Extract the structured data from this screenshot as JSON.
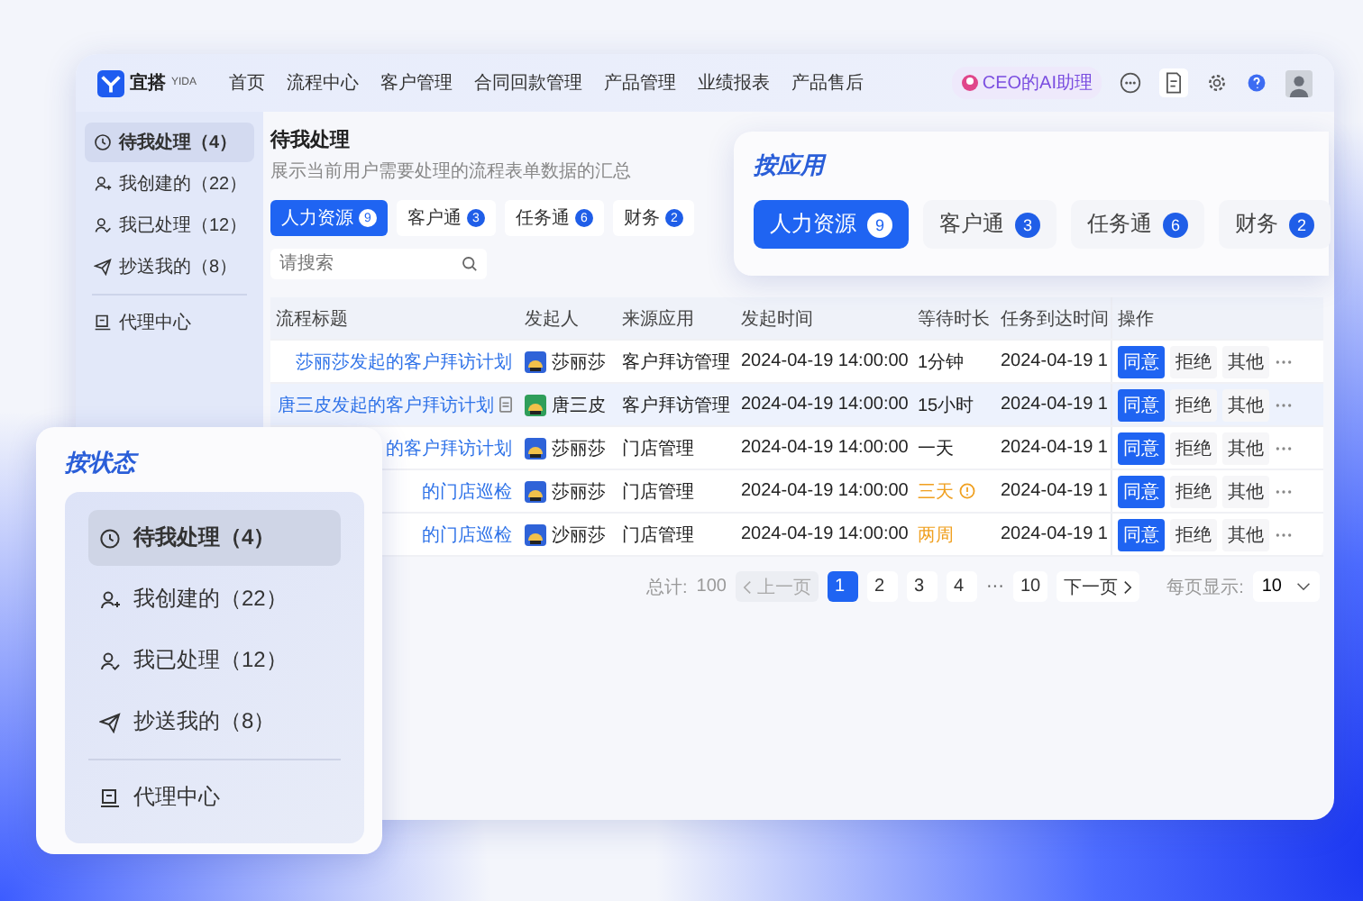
{
  "nav": {
    "logo": "宜搭",
    "logo_sub": "YIDA",
    "items": [
      "首页",
      "流程中心",
      "客户管理",
      "合同回款管理",
      "产品管理",
      "业绩报表",
      "产品售后"
    ],
    "assistant": "CEO的AI助理"
  },
  "sidebar": {
    "items": [
      {
        "label": "待我处理（4）",
        "kind": "clock",
        "selected": true
      },
      {
        "label": "我创建的（22）",
        "kind": "user-plus",
        "selected": false
      },
      {
        "label": "我已处理（12）",
        "kind": "user-check",
        "selected": false
      },
      {
        "label": "抄送我的（8）",
        "kind": "send",
        "selected": false
      }
    ],
    "footer_item": {
      "label": "代理中心",
      "kind": "book",
      "selected": false
    }
  },
  "page": {
    "title": "待我处理",
    "subtitle": "展示当前用户需要处理的流程表单数据的汇总",
    "tabs": [
      {
        "label": "人力资源",
        "count": "9",
        "selected": true
      },
      {
        "label": "客户通",
        "count": "3",
        "selected": false
      },
      {
        "label": "任务通",
        "count": "6",
        "selected": false
      },
      {
        "label": "财务",
        "count": "2",
        "selected": false
      }
    ],
    "search": {
      "placeholder": "请搜索"
    }
  },
  "table": {
    "columns": [
      "流程标题",
      "发起人",
      "来源应用",
      "发起时间",
      "等待时长",
      "任务到达时间",
      "操作"
    ],
    "rows": [
      {
        "title": "莎丽莎发起的客户拜访计划",
        "doc": false,
        "initiator": "莎丽莎",
        "color": "#2f63d8",
        "app": "客户拜访管理",
        "time": "2024-04-19 14:00:00",
        "wait": "1分钟",
        "overdue": false,
        "alert": false,
        "arrival": "2024-04-19 1",
        "selected": false,
        "actions": [
          "同意",
          "拒绝",
          "其他"
        ]
      },
      {
        "title": "唐三皮发起的客户拜访计划",
        "doc": true,
        "initiator": "唐三皮",
        "color": "#2f9e5a",
        "app": "客户拜访管理",
        "time": "2024-04-19 14:00:00",
        "wait": "15小时",
        "overdue": false,
        "alert": false,
        "arrival": "2024-04-19 1",
        "selected": true,
        "actions": [
          "同意",
          "拒绝",
          "其他"
        ]
      },
      {
        "title": "的客户拜访计划",
        "doc": false,
        "initiator": "莎丽莎",
        "color": "#2f63d8",
        "app": "门店管理",
        "time": "2024-04-19 14:00:00",
        "wait": "一天",
        "overdue": false,
        "alert": false,
        "arrival": "2024-04-19 1",
        "selected": false,
        "actions": [
          "同意",
          "拒绝",
          "其他"
        ]
      },
      {
        "title": "的门店巡检",
        "doc": false,
        "initiator": "莎丽莎",
        "color": "#2f63d8",
        "app": "门店管理",
        "time": "2024-04-19 14:00:00",
        "wait": "三天",
        "overdue": true,
        "alert": true,
        "arrival": "2024-04-19 1",
        "selected": false,
        "actions": [
          "同意",
          "拒绝",
          "其他"
        ]
      },
      {
        "title": "的门店巡检",
        "doc": false,
        "initiator": "沙丽莎",
        "color": "#2f63d8",
        "app": "门店管理",
        "time": "2024-04-19 14:00:00",
        "wait": "两周",
        "overdue": true,
        "alert": false,
        "arrival": "2024-04-19 1",
        "selected": false,
        "actions": [
          "同意",
          "拒绝",
          "其他"
        ]
      }
    ]
  },
  "pagination": {
    "total_label": "总计:",
    "total": "100",
    "prev": "上一页",
    "prev_disabled": true,
    "pages": [
      {
        "label": "1",
        "kind": "page",
        "selected": true
      },
      {
        "label": "2",
        "kind": "page",
        "selected": false
      },
      {
        "label": "3",
        "kind": "page",
        "selected": false
      },
      {
        "label": "4",
        "kind": "page",
        "selected": false
      },
      {
        "label": "···",
        "kind": "ellipsis"
      },
      {
        "label": "10",
        "kind": "page",
        "selected": false
      }
    ],
    "next": "下一页",
    "page_size_label": "每页显示:",
    "page_size": "10"
  },
  "app_card": {
    "title": "按应用",
    "tabs": [
      {
        "label": "人力资源",
        "count": "9",
        "selected": true
      },
      {
        "label": "客户通",
        "count": "3",
        "selected": false
      },
      {
        "label": "任务通",
        "count": "6",
        "selected": false
      },
      {
        "label": "财务",
        "count": "2",
        "selected": false
      }
    ]
  },
  "status_card": {
    "title": "按状态",
    "items": [
      {
        "label": "待我处理（4）",
        "kind": "clock",
        "selected": true
      },
      {
        "label": "我创建的（22）",
        "kind": "user-plus",
        "selected": false
      },
      {
        "label": "我已处理（12）",
        "kind": "user-check",
        "selected": false
      },
      {
        "label": "抄送我的（8）",
        "kind": "send",
        "selected": false
      }
    ],
    "footer_item": {
      "label": "代理中心",
      "kind": "book",
      "selected": false
    }
  }
}
